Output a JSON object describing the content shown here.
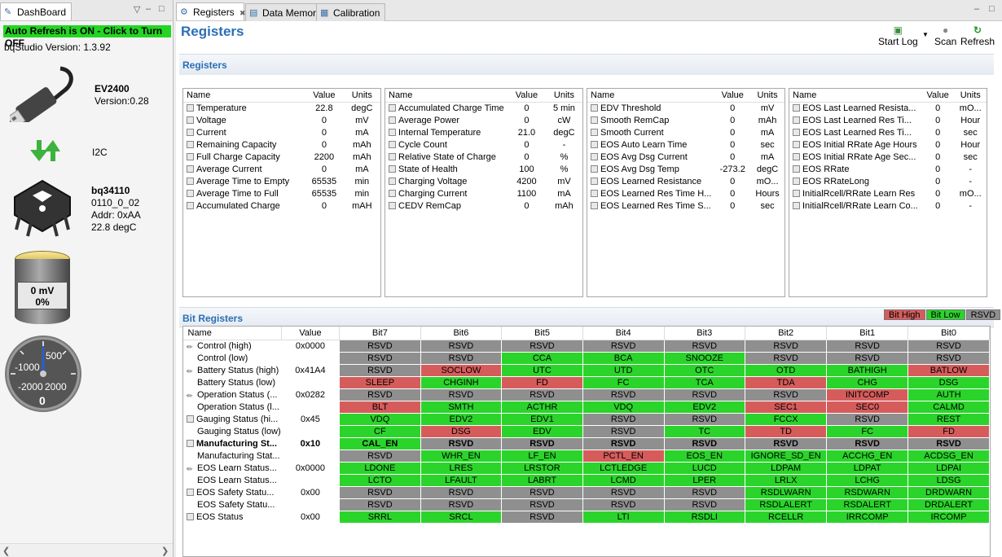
{
  "left": {
    "tab_label": "DashBoard",
    "auto_refresh": "Auto Refresh is ON - Click to Turn OFF",
    "version": "bqStudio Version:  1.3.92",
    "adapter_name": "EV2400",
    "adapter_version": "Version:0.28",
    "bus": "I2C",
    "device_name": "bq34110",
    "device_id": "0110_0_02",
    "device_addr": "Addr: 0xAA",
    "device_temp": "22.8 degC",
    "battery_mv": "0 mV",
    "battery_pct": "0%",
    "gauge": {
      "t500": "500",
      "t1000": "-1000",
      "t2000": "-2000",
      "t2000b": "2000",
      "value": "0"
    }
  },
  "tabs": [
    {
      "label": "Registers",
      "icon": "registers-icon"
    },
    {
      "label": "Data Memory",
      "icon": "data-memory-icon"
    },
    {
      "label": "Calibration",
      "icon": "calibration-icon"
    }
  ],
  "page_title": "Registers",
  "toolbar": {
    "start_log": "Start Log",
    "scan": "Scan",
    "refresh": "Refresh"
  },
  "registers_section": "Registers",
  "reg_headers": {
    "name": "Name",
    "value": "Value",
    "units": "Units"
  },
  "register_tables": [
    [
      {
        "n": "Temperature",
        "v": "22.8",
        "u": "degC"
      },
      {
        "n": "Voltage",
        "v": "0",
        "u": "mV"
      },
      {
        "n": "Current",
        "v": "0",
        "u": "mA"
      },
      {
        "n": "Remaining Capacity",
        "v": "0",
        "u": "mAh"
      },
      {
        "n": "Full Charge Capacity",
        "v": "2200",
        "u": "mAh"
      },
      {
        "n": "Average Current",
        "v": "0",
        "u": "mA"
      },
      {
        "n": "Average Time to Empty",
        "v": "65535",
        "u": "min"
      },
      {
        "n": "Average Time to Full",
        "v": "65535",
        "u": "min"
      },
      {
        "n": "Accumulated Charge",
        "v": "0",
        "u": "mAH"
      }
    ],
    [
      {
        "n": "Accumulated Charge Time",
        "v": "0",
        "u": "5 min"
      },
      {
        "n": "Average Power",
        "v": "0",
        "u": "cW"
      },
      {
        "n": "Internal Temperature",
        "v": "21.0",
        "u": "degC"
      },
      {
        "n": "Cycle Count",
        "v": "0",
        "u": "-"
      },
      {
        "n": "Relative State of Charge",
        "v": "0",
        "u": "%"
      },
      {
        "n": "State of Health",
        "v": "100",
        "u": "%"
      },
      {
        "n": "Charging Voltage",
        "v": "4200",
        "u": "mV"
      },
      {
        "n": "Charging Current",
        "v": "1100",
        "u": "mA"
      },
      {
        "n": "CEDV RemCap",
        "v": "0",
        "u": "mAh"
      }
    ],
    [
      {
        "n": "EDV Threshold",
        "v": "0",
        "u": "mV"
      },
      {
        "n": "Smooth RemCap",
        "v": "0",
        "u": "mAh"
      },
      {
        "n": "Smooth Current",
        "v": "0",
        "u": "mA"
      },
      {
        "n": "EOS Auto Learn Time",
        "v": "0",
        "u": "sec"
      },
      {
        "n": "EOS Avg Dsg Current",
        "v": "0",
        "u": "mA"
      },
      {
        "n": "EOS Avg Dsg Temp",
        "v": "-273.2",
        "u": "degC"
      },
      {
        "n": "EOS Learned Resistance",
        "v": "0",
        "u": "mO..."
      },
      {
        "n": "EOS Learned Res Time H...",
        "v": "0",
        "u": "Hours"
      },
      {
        "n": "EOS Learned Res Time S...",
        "v": "0",
        "u": "sec"
      }
    ],
    [
      {
        "n": "EOS Last Learned Resista...",
        "v": "0",
        "u": "mO..."
      },
      {
        "n": "EOS Last Learned Res Ti...",
        "v": "0",
        "u": "Hour"
      },
      {
        "n": "EOS Last Learned Res Ti...",
        "v": "0",
        "u": "sec"
      },
      {
        "n": "EOS Initial RRate Age Hours",
        "v": "0",
        "u": "Hour"
      },
      {
        "n": "EOS Initial RRate Age Sec...",
        "v": "0",
        "u": "sec"
      },
      {
        "n": "EOS RRate",
        "v": "0",
        "u": "-"
      },
      {
        "n": "EOS RRateLong",
        "v": "0",
        "u": "-"
      },
      {
        "n": "InitialRcell/RRate Learn Res",
        "v": "0",
        "u": "mO..."
      },
      {
        "n": "InitialRcell/RRate Learn Co...",
        "v": "0",
        "u": "-"
      }
    ]
  ],
  "bit_section": "Bit Registers",
  "legend": {
    "high": "Bit High",
    "low": "Bit Low",
    "rsvd": "RSVD"
  },
  "bit_headers": [
    "Name",
    "Value",
    "Bit7",
    "Bit6",
    "Bit5",
    "Bit4",
    "Bit3",
    "Bit2",
    "Bit1",
    "Bit0"
  ],
  "bit_rows": [
    {
      "n": "Control (high)",
      "v": "0x0000",
      "ic": "pen",
      "b": [
        [
          "RSVD",
          "x"
        ],
        [
          "RSVD",
          "x"
        ],
        [
          "RSVD",
          "x"
        ],
        [
          "RSVD",
          "x"
        ],
        [
          "RSVD",
          "x"
        ],
        [
          "RSVD",
          "x"
        ],
        [
          "RSVD",
          "x"
        ],
        [
          "RSVD",
          "x"
        ]
      ]
    },
    {
      "n": "Control (low)",
      "v": "",
      "ic": "",
      "b": [
        [
          "RSVD",
          "x"
        ],
        [
          "RSVD",
          "x"
        ],
        [
          "CCA",
          "g"
        ],
        [
          "BCA",
          "g"
        ],
        [
          "SNOOZE",
          "g"
        ],
        [
          "RSVD",
          "x"
        ],
        [
          "RSVD",
          "x"
        ],
        [
          "RSVD",
          "x"
        ]
      ]
    },
    {
      "n": "Battery Status (high)",
      "v": "0x41A4",
      "ic": "pen",
      "b": [
        [
          "RSVD",
          "x"
        ],
        [
          "SOCLOW",
          "r"
        ],
        [
          "UTC",
          "g"
        ],
        [
          "UTD",
          "g"
        ],
        [
          "OTC",
          "g"
        ],
        [
          "OTD",
          "g"
        ],
        [
          "BATHIGH",
          "g"
        ],
        [
          "BATLOW",
          "r"
        ]
      ]
    },
    {
      "n": "Battery Status (low)",
      "v": "",
      "ic": "",
      "b": [
        [
          "SLEEP",
          "r"
        ],
        [
          "CHGINH",
          "g"
        ],
        [
          "FD",
          "r"
        ],
        [
          "FC",
          "g"
        ],
        [
          "TCA",
          "g"
        ],
        [
          "TDA",
          "r"
        ],
        [
          "CHG",
          "g"
        ],
        [
          "DSG",
          "g"
        ]
      ]
    },
    {
      "n": "Operation Status (...",
      "v": "0x0282",
      "ic": "pen",
      "b": [
        [
          "RSVD",
          "x"
        ],
        [
          "RSVD",
          "x"
        ],
        [
          "RSVD",
          "x"
        ],
        [
          "RSVD",
          "x"
        ],
        [
          "RSVD",
          "x"
        ],
        [
          "RSVD",
          "x"
        ],
        [
          "INITCOMP",
          "r"
        ],
        [
          "AUTH",
          "g"
        ]
      ]
    },
    {
      "n": "Operation Status (l...",
      "v": "",
      "ic": "",
      "b": [
        [
          "BLT",
          "r"
        ],
        [
          "SMTH",
          "g"
        ],
        [
          "ACTHR",
          "g"
        ],
        [
          "VDQ",
          "g"
        ],
        [
          "EDV2",
          "g"
        ],
        [
          "SEC1",
          "r"
        ],
        [
          "SEC0",
          "r"
        ],
        [
          "CALMD",
          "g"
        ]
      ]
    },
    {
      "n": "Gauging Status (hi...",
      "v": "0x45",
      "ic": "sc",
      "b": [
        [
          "VDQ",
          "g"
        ],
        [
          "EDV2",
          "g"
        ],
        [
          "EDV1",
          "g"
        ],
        [
          "RSVD",
          "x"
        ],
        [
          "RSVD",
          "x"
        ],
        [
          "FCCX",
          "g"
        ],
        [
          "RSVD",
          "x"
        ],
        [
          "REST",
          "g"
        ]
      ]
    },
    {
      "n": "Gauging Status (low)",
      "v": "",
      "ic": "",
      "b": [
        [
          "CF",
          "g"
        ],
        [
          "DSG",
          "r"
        ],
        [
          "EDV",
          "g"
        ],
        [
          "RSVD",
          "x"
        ],
        [
          "TC",
          "g"
        ],
        [
          "TD",
          "r"
        ],
        [
          "FC",
          "g"
        ],
        [
          "FD",
          "r"
        ]
      ]
    },
    {
      "n": "Manufacturing St...",
      "v": "0x10",
      "ic": "sc",
      "bold": true,
      "b": [
        [
          "CAL_EN",
          "g"
        ],
        [
          "RSVD",
          "x"
        ],
        [
          "RSVD",
          "x"
        ],
        [
          "RSVD",
          "x"
        ],
        [
          "RSVD",
          "x"
        ],
        [
          "RSVD",
          "x"
        ],
        [
          "RSVD",
          "x"
        ],
        [
          "RSVD",
          "x"
        ]
      ]
    },
    {
      "n": "Manufacturing Stat...",
      "v": "",
      "ic": "",
      "b": [
        [
          "RSVD",
          "x"
        ],
        [
          "WHR_EN",
          "g"
        ],
        [
          "LF_EN",
          "g"
        ],
        [
          "PCTL_EN",
          "r"
        ],
        [
          "EOS_EN",
          "g"
        ],
        [
          "IGNORE_SD_EN",
          "g"
        ],
        [
          "ACCHG_EN",
          "g"
        ],
        [
          "ACDSG_EN",
          "g"
        ]
      ]
    },
    {
      "n": "EOS Learn Status...",
      "v": "0x0000",
      "ic": "pen",
      "b": [
        [
          "LDONE",
          "g"
        ],
        [
          "LRES",
          "g"
        ],
        [
          "LRSTOR",
          "g"
        ],
        [
          "LCTLEDGE",
          "g"
        ],
        [
          "LUCD",
          "g"
        ],
        [
          "LDPAM",
          "g"
        ],
        [
          "LDPAT",
          "g"
        ],
        [
          "LDPAI",
          "g"
        ]
      ]
    },
    {
      "n": "EOS Learn Status...",
      "v": "",
      "ic": "",
      "b": [
        [
          "LCTO",
          "g"
        ],
        [
          "LFAULT",
          "g"
        ],
        [
          "LABRT",
          "g"
        ],
        [
          "LCMD",
          "g"
        ],
        [
          "LPER",
          "g"
        ],
        [
          "LRLX",
          "g"
        ],
        [
          "LCHG",
          "g"
        ],
        [
          "LDSG",
          "g"
        ]
      ]
    },
    {
      "n": "EOS Safety Statu...",
      "v": "0x00",
      "ic": "sc",
      "b": [
        [
          "RSVD",
          "x"
        ],
        [
          "RSVD",
          "x"
        ],
        [
          "RSVD",
          "x"
        ],
        [
          "RSVD",
          "x"
        ],
        [
          "RSVD",
          "x"
        ],
        [
          "RSDLWARN",
          "g"
        ],
        [
          "RSDWARN",
          "g"
        ],
        [
          "DRDWARN",
          "g"
        ]
      ]
    },
    {
      "n": "EOS Safety Statu...",
      "v": "",
      "ic": "",
      "b": [
        [
          "RSVD",
          "x"
        ],
        [
          "RSVD",
          "x"
        ],
        [
          "RSVD",
          "x"
        ],
        [
          "RSVD",
          "x"
        ],
        [
          "RSVD",
          "x"
        ],
        [
          "RSDLALERT",
          "g"
        ],
        [
          "RSDALERT",
          "g"
        ],
        [
          "DRDALERT",
          "g"
        ]
      ]
    },
    {
      "n": "EOS Status",
      "v": "0x00",
      "ic": "sc",
      "b": [
        [
          "SRRL",
          "g"
        ],
        [
          "SRCL",
          "g"
        ],
        [
          "RSVD",
          "x"
        ],
        [
          "LTI",
          "g"
        ],
        [
          "RSDLI",
          "g"
        ],
        [
          "RCELLR",
          "g"
        ],
        [
          "IRRCOMP",
          "g"
        ],
        [
          "IRCOMP",
          "g"
        ]
      ]
    }
  ]
}
